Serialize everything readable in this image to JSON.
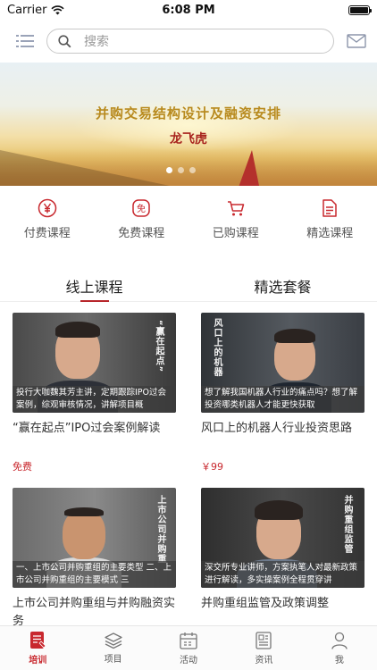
{
  "status_bar": {
    "carrier": "Carrier",
    "time": "6:08 PM"
  },
  "search": {
    "placeholder": "搜索"
  },
  "banner": {
    "title": "并购交易结构设计及融资安排",
    "author": "龙飞虎"
  },
  "quick_menu": [
    {
      "label": "付费课程",
      "icon": "yen-icon"
    },
    {
      "label": "免费课程",
      "icon": "free-icon"
    },
    {
      "label": "已购课程",
      "icon": "cart-icon"
    },
    {
      "label": "精选课程",
      "icon": "document-icon"
    }
  ],
  "tabs": [
    {
      "label": "线上课程"
    },
    {
      "label": "精选套餐"
    }
  ],
  "courses": [
    {
      "caption": "投行大咖魏其芳主讲，定期跟踪IPO过会案例，综观审核情况，讲解项目概",
      "poster_text": "“赢在起点”",
      "title": "“赢在起点”IPO过会案例解读",
      "price": "免费"
    },
    {
      "caption": "想了解我国机器人行业的痛点吗？想了解投资哪类机器人才能更快获取",
      "poster_text": "风口上的机器",
      "title": "风口上的机器人行业投资思路",
      "price": "￥99"
    },
    {
      "caption": "一、上市公司并购重组的主要类型 二、上市公司并购重组的主要模式 三",
      "poster_text": "上市公司并购重",
      "title": "上市公司并购重组与并购融资实务",
      "price": ""
    },
    {
      "caption": "深交所专业讲师，方案执笔人对最新政策进行解读，多实操案例全程贯穿讲",
      "poster_text": "并购重组监管",
      "title": "并购重组监管及政策调整",
      "price": ""
    }
  ],
  "tab_bar": [
    {
      "label": "培训",
      "icon": "training-icon"
    },
    {
      "label": "项目",
      "icon": "layers-icon"
    },
    {
      "label": "活动",
      "icon": "calendar-icon"
    },
    {
      "label": "资讯",
      "icon": "news-icon"
    },
    {
      "label": "我",
      "icon": "person-icon"
    }
  ],
  "colors": {
    "accent": "#c8282e"
  }
}
